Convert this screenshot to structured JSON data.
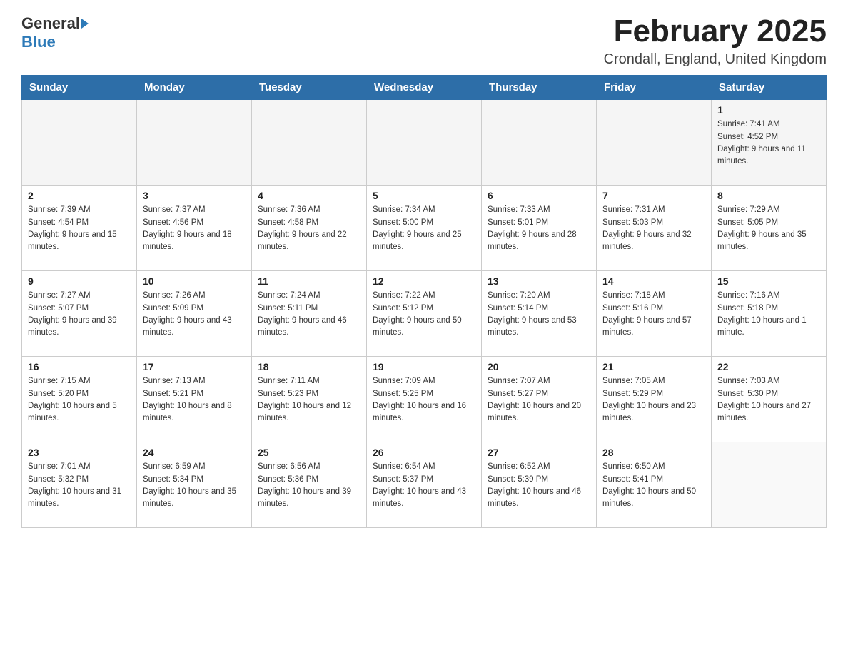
{
  "header": {
    "logo_general": "General",
    "logo_blue": "Blue",
    "title": "February 2025",
    "subtitle": "Crondall, England, United Kingdom"
  },
  "weekdays": [
    "Sunday",
    "Monday",
    "Tuesday",
    "Wednesday",
    "Thursday",
    "Friday",
    "Saturday"
  ],
  "weeks": [
    [
      {
        "day": "",
        "info": ""
      },
      {
        "day": "",
        "info": ""
      },
      {
        "day": "",
        "info": ""
      },
      {
        "day": "",
        "info": ""
      },
      {
        "day": "",
        "info": ""
      },
      {
        "day": "",
        "info": ""
      },
      {
        "day": "1",
        "info": "Sunrise: 7:41 AM\nSunset: 4:52 PM\nDaylight: 9 hours and 11 minutes."
      }
    ],
    [
      {
        "day": "2",
        "info": "Sunrise: 7:39 AM\nSunset: 4:54 PM\nDaylight: 9 hours and 15 minutes."
      },
      {
        "day": "3",
        "info": "Sunrise: 7:37 AM\nSunset: 4:56 PM\nDaylight: 9 hours and 18 minutes."
      },
      {
        "day": "4",
        "info": "Sunrise: 7:36 AM\nSunset: 4:58 PM\nDaylight: 9 hours and 22 minutes."
      },
      {
        "day": "5",
        "info": "Sunrise: 7:34 AM\nSunset: 5:00 PM\nDaylight: 9 hours and 25 minutes."
      },
      {
        "day": "6",
        "info": "Sunrise: 7:33 AM\nSunset: 5:01 PM\nDaylight: 9 hours and 28 minutes."
      },
      {
        "day": "7",
        "info": "Sunrise: 7:31 AM\nSunset: 5:03 PM\nDaylight: 9 hours and 32 minutes."
      },
      {
        "day": "8",
        "info": "Sunrise: 7:29 AM\nSunset: 5:05 PM\nDaylight: 9 hours and 35 minutes."
      }
    ],
    [
      {
        "day": "9",
        "info": "Sunrise: 7:27 AM\nSunset: 5:07 PM\nDaylight: 9 hours and 39 minutes."
      },
      {
        "day": "10",
        "info": "Sunrise: 7:26 AM\nSunset: 5:09 PM\nDaylight: 9 hours and 43 minutes."
      },
      {
        "day": "11",
        "info": "Sunrise: 7:24 AM\nSunset: 5:11 PM\nDaylight: 9 hours and 46 minutes."
      },
      {
        "day": "12",
        "info": "Sunrise: 7:22 AM\nSunset: 5:12 PM\nDaylight: 9 hours and 50 minutes."
      },
      {
        "day": "13",
        "info": "Sunrise: 7:20 AM\nSunset: 5:14 PM\nDaylight: 9 hours and 53 minutes."
      },
      {
        "day": "14",
        "info": "Sunrise: 7:18 AM\nSunset: 5:16 PM\nDaylight: 9 hours and 57 minutes."
      },
      {
        "day": "15",
        "info": "Sunrise: 7:16 AM\nSunset: 5:18 PM\nDaylight: 10 hours and 1 minute."
      }
    ],
    [
      {
        "day": "16",
        "info": "Sunrise: 7:15 AM\nSunset: 5:20 PM\nDaylight: 10 hours and 5 minutes."
      },
      {
        "day": "17",
        "info": "Sunrise: 7:13 AM\nSunset: 5:21 PM\nDaylight: 10 hours and 8 minutes."
      },
      {
        "day": "18",
        "info": "Sunrise: 7:11 AM\nSunset: 5:23 PM\nDaylight: 10 hours and 12 minutes."
      },
      {
        "day": "19",
        "info": "Sunrise: 7:09 AM\nSunset: 5:25 PM\nDaylight: 10 hours and 16 minutes."
      },
      {
        "day": "20",
        "info": "Sunrise: 7:07 AM\nSunset: 5:27 PM\nDaylight: 10 hours and 20 minutes."
      },
      {
        "day": "21",
        "info": "Sunrise: 7:05 AM\nSunset: 5:29 PM\nDaylight: 10 hours and 23 minutes."
      },
      {
        "day": "22",
        "info": "Sunrise: 7:03 AM\nSunset: 5:30 PM\nDaylight: 10 hours and 27 minutes."
      }
    ],
    [
      {
        "day": "23",
        "info": "Sunrise: 7:01 AM\nSunset: 5:32 PM\nDaylight: 10 hours and 31 minutes."
      },
      {
        "day": "24",
        "info": "Sunrise: 6:59 AM\nSunset: 5:34 PM\nDaylight: 10 hours and 35 minutes."
      },
      {
        "day": "25",
        "info": "Sunrise: 6:56 AM\nSunset: 5:36 PM\nDaylight: 10 hours and 39 minutes."
      },
      {
        "day": "26",
        "info": "Sunrise: 6:54 AM\nSunset: 5:37 PM\nDaylight: 10 hours and 43 minutes."
      },
      {
        "day": "27",
        "info": "Sunrise: 6:52 AM\nSunset: 5:39 PM\nDaylight: 10 hours and 46 minutes."
      },
      {
        "day": "28",
        "info": "Sunrise: 6:50 AM\nSunset: 5:41 PM\nDaylight: 10 hours and 50 minutes."
      },
      {
        "day": "",
        "info": ""
      }
    ]
  ]
}
